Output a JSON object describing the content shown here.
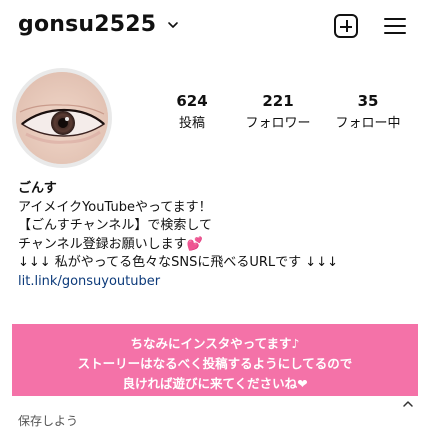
{
  "header": {
    "username": "gonsu2525",
    "chevron_icon": "chevron-down-icon",
    "add_icon": "plus-square-icon",
    "menu_icon": "hamburger-menu-icon"
  },
  "profile": {
    "stats": [
      {
        "value": "624",
        "label": "投稿"
      },
      {
        "value": "221",
        "label": "フォロワー"
      },
      {
        "value": "35",
        "label": "フォロー中"
      }
    ]
  },
  "bio": {
    "name": "ごんす",
    "lines": [
      "アイメイクYouTubeやってます！",
      "【ごんすチャンネル】で検索して",
      "チャンネル登録お願いします💕",
      "↓↓↓ 私がやってる色々なSNSに飛べるURLです ↓↓↓"
    ],
    "link": "lit.link/gonsuyoutuber"
  },
  "banner": {
    "lines": [
      "ちなみにインスタやってます♪",
      "ストーリーはなるべく投稿するようにしてるので",
      "良ければ遊びに来てくださいね❤"
    ],
    "color": "#f472a8"
  },
  "below_text": "保存しよう"
}
